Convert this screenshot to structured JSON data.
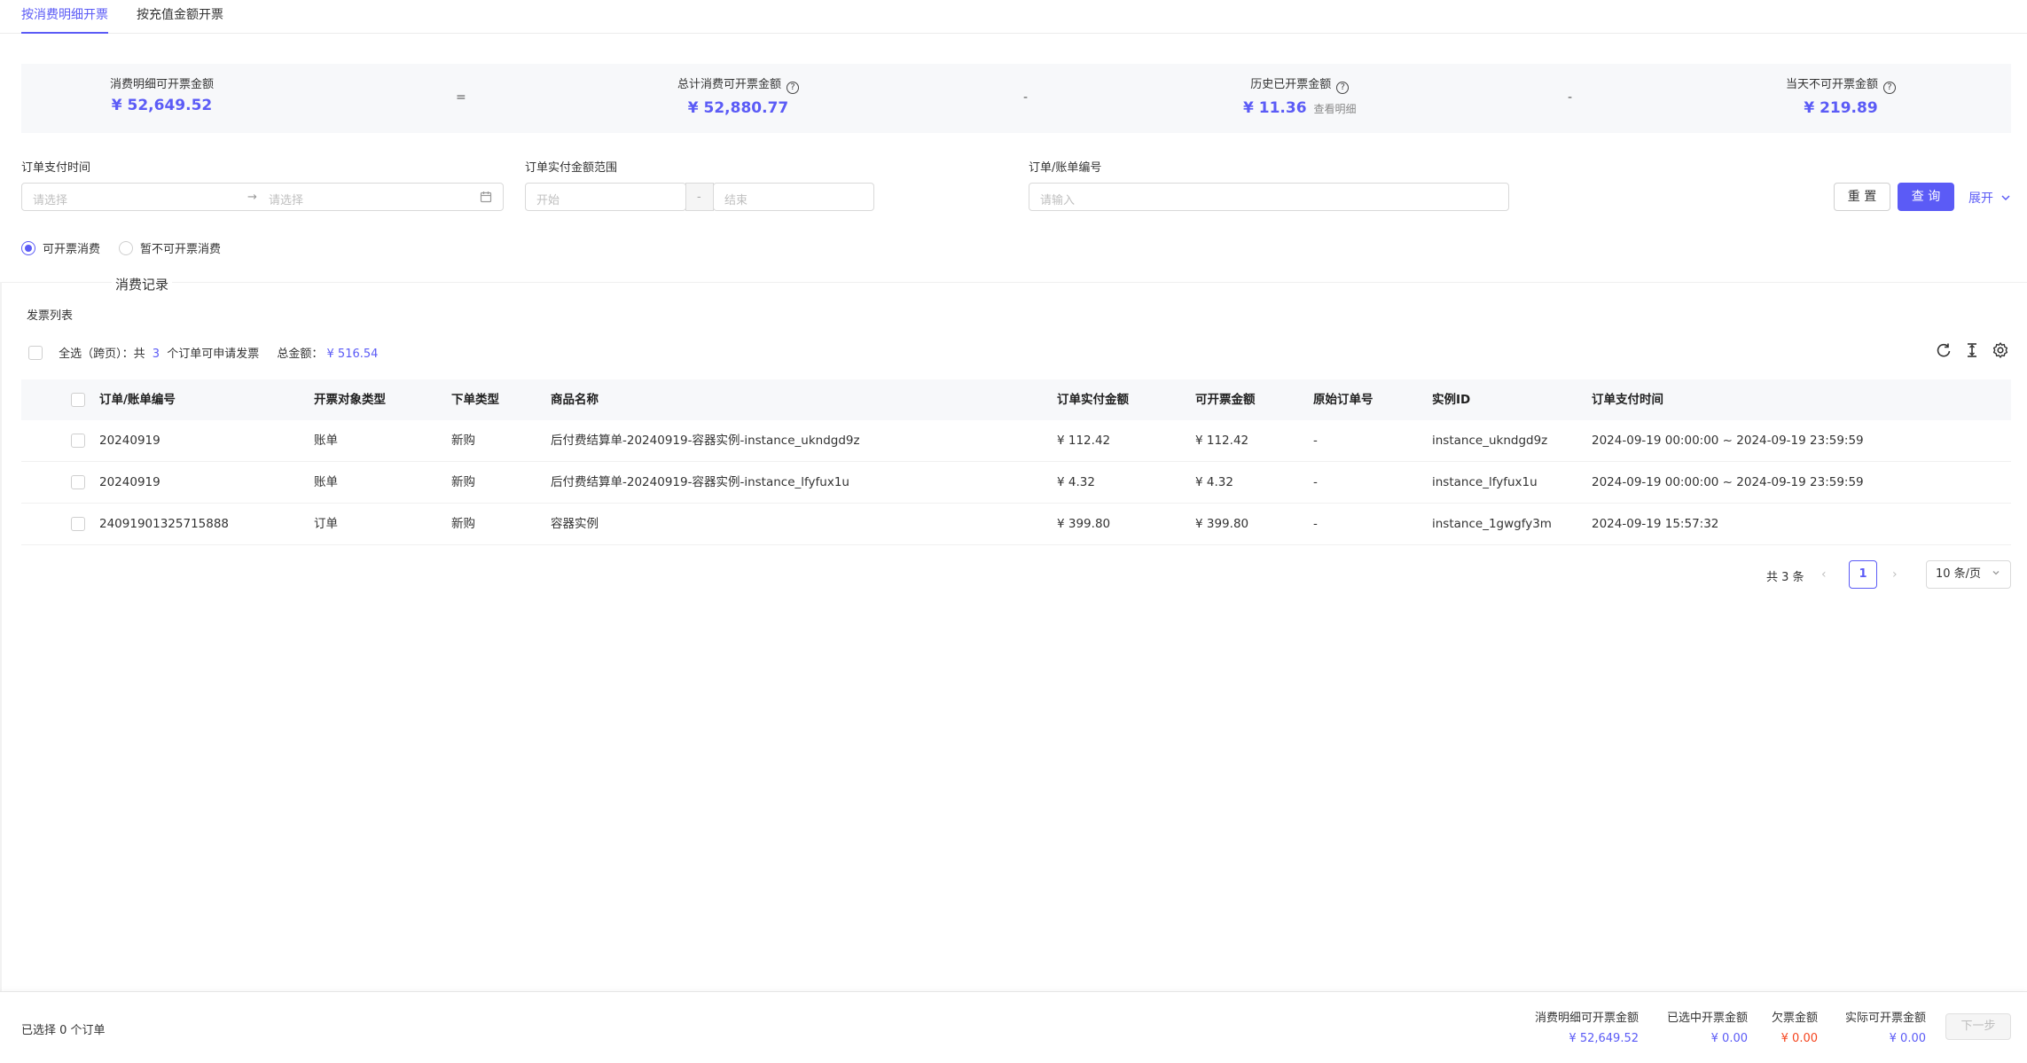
{
  "tabs": [
    {
      "label": "按消费明细开票",
      "active": true
    },
    {
      "label": "按充值金额开票",
      "active": false
    }
  ],
  "summary": {
    "items": [
      {
        "label": "消费明细可开票金额",
        "value": "¥ 52,649.52",
        "help": false
      },
      {
        "label": "总计消费可开票金额",
        "value": "¥ 52,880.77",
        "help": true
      },
      {
        "label": "历史已开票金额",
        "value": "¥ 11.36",
        "help": true,
        "link": "查看明细"
      },
      {
        "label": "当天不可开票金额",
        "value": "¥ 219.89",
        "help": true
      }
    ],
    "operators": [
      "=",
      "-",
      "-"
    ]
  },
  "filters": {
    "pay_time": {
      "label": "订单支付时间",
      "start_placeholder": "请选择",
      "end_placeholder": "请选择"
    },
    "amount_range": {
      "label": "订单实付金额范围",
      "start_placeholder": "开始",
      "separator": "-",
      "end_placeholder": "结束"
    },
    "order_no": {
      "label": "订单/账单编号",
      "placeholder": "请输入"
    },
    "reset_label": "重 置",
    "query_label": "查 询",
    "expand_label": "展开"
  },
  "radios": [
    {
      "label": "可开票消费",
      "checked": true
    },
    {
      "label": "暂不可开票消费",
      "checked": false
    }
  ],
  "section_title": "消费记录",
  "list_title": "发票列表",
  "selection": {
    "prefix": "全选（跨页）：共",
    "count": "3",
    "suffix": "个订单可申请发票",
    "total_label": "总金额：",
    "total_value": "¥ 516.54"
  },
  "toolbar_icons": [
    "refresh-icon",
    "column-height-icon",
    "settings-icon"
  ],
  "table": {
    "columns": [
      "订单/账单编号",
      "开票对象类型",
      "下单类型",
      "商品名称",
      "订单实付金额",
      "可开票金额",
      "原始订单号",
      "实例ID",
      "订单支付时间"
    ],
    "rows": [
      [
        "20240919",
        "账单",
        "新购",
        "后付费结算单-20240919-容器实例-instance_ukndgd9z",
        "¥ 112.42",
        "¥ 112.42",
        "-",
        "instance_ukndgd9z",
        "2024-09-19 00:00:00 ~ 2024-09-19 23:59:59"
      ],
      [
        "20240919",
        "账单",
        "新购",
        "后付费结算单-20240919-容器实例-instance_lfyfux1u",
        "¥ 4.32",
        "¥ 4.32",
        "-",
        "instance_lfyfux1u",
        "2024-09-19 00:00:00 ~ 2024-09-19 23:59:59"
      ],
      [
        "24091901325715888",
        "订单",
        "新购",
        "容器实例",
        "¥ 399.80",
        "¥ 399.80",
        "-",
        "instance_1gwgfy3m",
        "2024-09-19 15:57:32"
      ]
    ]
  },
  "pagination": {
    "total": "共 3 条",
    "current": "1",
    "page_size": "10 条/页"
  },
  "footer": {
    "selected": "已选择 0 个订单",
    "stats": [
      {
        "label": "消费明细可开票金额",
        "value": "¥ 52,649.52",
        "color": "#5b5bf6"
      },
      {
        "label": "已选中开票金额",
        "value": "¥ 0.00",
        "color": "#5b5bf6"
      },
      {
        "label": "欠票金额",
        "value": "¥ 0.00",
        "color": "#f5451f"
      },
      {
        "label": "实际可开票金额",
        "value": "¥ 0.00",
        "color": "#5b5bf6"
      }
    ],
    "next_label": "下一步"
  },
  "colors": {
    "accent": "#5b5bf6",
    "danger": "#f5451f"
  }
}
